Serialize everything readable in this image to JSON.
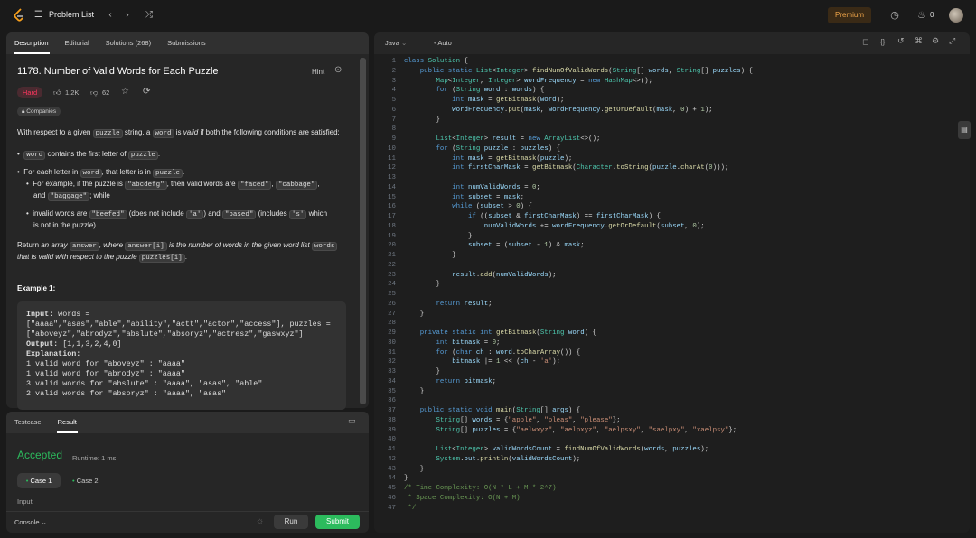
{
  "topbar": {
    "title": "Problem List",
    "premium": "Premium",
    "streak": "0"
  },
  "left_tabs": [
    "Description",
    "Editorial",
    "Solutions (268)",
    "Submissions"
  ],
  "problem": {
    "title": "1178. Number of Valid Words for Each Puzzle",
    "hint": "Hint",
    "difficulty": "Hard",
    "likes": "1.2K",
    "dislikes": "62",
    "companies": "Companies"
  },
  "description": {
    "p1_a": "With respect to a given ",
    "p1_code1": "puzzle",
    "p1_b": " string, a ",
    "p1_code2": "word",
    "p1_c": " is ",
    "p1_em": "valid",
    "p1_d": " if both the following conditions are satisfied:",
    "b1_code": "word",
    "b1_text": " contains the first letter of ",
    "b1_code2": "puzzle",
    "b1_end": ".",
    "b2_a": "For each letter in ",
    "b2_code": "word",
    "b2_b": ", that letter is in ",
    "b2_code2": "puzzle",
    "b2_end": ".",
    "s1_a": "For example, if the puzzle is ",
    "s1_c1": "\"abcdefg\"",
    "s1_b": ", then valid words are ",
    "s1_c2": "\"faced\"",
    "s1_sep": ", ",
    "s1_c3": "\"cabbage\"",
    "s1_and": "and ",
    "s1_c4": "\"baggage\"",
    "s1_end": "; while",
    "s2_a": "invalid words are ",
    "s2_c1": "\"beefed\"",
    "s2_b": " (does not include ",
    "s2_c2": "'a'",
    "s2_c": ") and ",
    "s2_c3": "\"based\"",
    "s2_d": " (includes ",
    "s2_c4": "'s'",
    "s2_e": " which",
    "s2_f": "is not in the puzzle).",
    "r_a": "Return ",
    "r_em1": "an array ",
    "r_c1": "answer",
    "r_em2": ", where ",
    "r_c2": "answer[i]",
    "r_em3": " is the number of words in the given word list ",
    "r_c3": "words",
    "r_em4": "that is valid with respect to the puzzle ",
    "r_c4": "puzzles[i]",
    "r_end": ".",
    "example_title": "Example 1:",
    "ex_l1_label": "Input:",
    "ex_l1": " words =",
    "ex_l2": "[\"aaaa\",\"asas\",\"able\",\"ability\",\"actt\",\"actor\",\"access\"], puzzles =",
    "ex_l3": "[\"aboveyz\",\"abrodyz\",\"abslute\",\"absoryz\",\"actresz\",\"gaswxyz\"]",
    "ex_l4_label": "Output:",
    "ex_l4": " [1,1,3,2,4,0]",
    "ex_l5_label": "Explanation:",
    "ex_l6": "1 valid word for \"aboveyz\" : \"aaaa\"",
    "ex_l7": "1 valid word for \"abrodyz\" : \"aaaa\"",
    "ex_l8": "3 valid words for \"abslute\" : \"aaaa\", \"asas\", \"able\"",
    "ex_l9": "2 valid words for \"absoryz\" : \"aaaa\", \"asas\""
  },
  "bottom": {
    "tabs": [
      "Testcase",
      "Result"
    ],
    "status": "Accepted",
    "runtime": "Runtime: 1 ms",
    "case1": "Case 1",
    "case2": "Case 2",
    "input_label": "Input",
    "console": "Console",
    "run": "Run",
    "submit": "Submit"
  },
  "editor": {
    "language": "Java",
    "mode": "Auto",
    "line_count": 47
  },
  "colors": {
    "accent_green": "#2cbb5d",
    "hard_red": "#ff375f",
    "premium": "#f0a54a"
  }
}
